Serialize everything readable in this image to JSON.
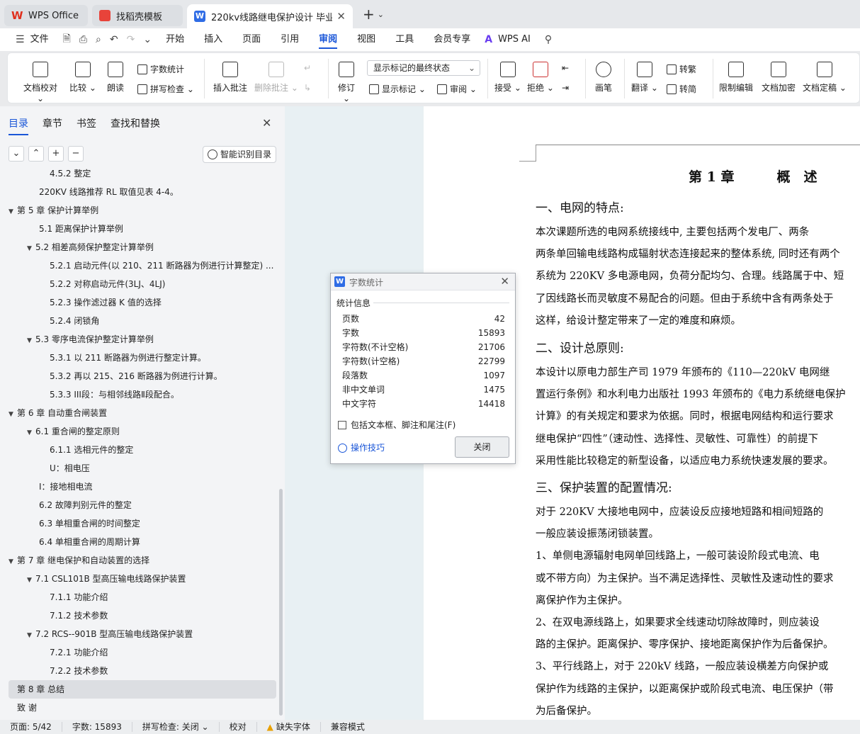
{
  "tabs": {
    "app_label": "WPS Office",
    "template_label": "找稻壳模板",
    "doc_label": "220kv线路继电保护设计  毕业"
  },
  "menu": [
    "文件",
    "开始",
    "插入",
    "页面",
    "引用",
    "审阅",
    "视图",
    "工具",
    "会员专享",
    "WPS AI"
  ],
  "menu_active": "审阅",
  "ribbon": {
    "proofread": "文档校对",
    "compare": "比较",
    "read_aloud": "朗读",
    "word_count": "字数统计",
    "spell_check": "拼写检查",
    "insert_comment": "插入批注",
    "delete_comment": "删除批注",
    "track": "修订",
    "markup_dropdown": "显示标记的最终状态",
    "show_markup": "显示标记",
    "review": "审阅",
    "accept": "接受",
    "reject": "拒绝",
    "pen": "画笔",
    "translate": "翻译",
    "to_trad": "转繁",
    "to_simp": "转简",
    "restrict": "限制编辑",
    "encrypt": "文档加密",
    "finalize": "文档定稿"
  },
  "panel": {
    "tabs": [
      "目录",
      "章节",
      "书签",
      "查找和替换"
    ],
    "smart_toc": "智能识别目录",
    "toc": [
      {
        "text": "4.5.2   整定",
        "level": 3,
        "tri": ""
      },
      {
        "text": "220KV 线路推荐 RL 取值见表 4-4。",
        "level": 2,
        "tri": ""
      },
      {
        "text": "第 5 章   保护计算举例",
        "level": 1,
        "tri": "▼"
      },
      {
        "text": "5.1  距离保护计算举例",
        "level": 2,
        "tri": ""
      },
      {
        "text": "5.2   相差高频保护整定计算举例",
        "level": 2,
        "tri": "▼"
      },
      {
        "text": "5.2.1 启动元件(以 210、211 断路器为例进行计算整定) ...",
        "level": 3,
        "tri": ""
      },
      {
        "text": "5.2.2 对称启动元件(3LJ、4LJ)",
        "level": 3,
        "tri": ""
      },
      {
        "text": "5.2.3 操作滤过器 K 值的选择",
        "level": 3,
        "tri": ""
      },
      {
        "text": "5.2.4    闭锁角",
        "level": 3,
        "tri": ""
      },
      {
        "text": "5.3    零序电流保护整定计算举例",
        "level": 2,
        "tri": "▼"
      },
      {
        "text": "5.3.1    以 211 断路器为例进行整定计算。",
        "level": 3,
        "tri": ""
      },
      {
        "text": "5.3.2    再以 215、216 断路器为例进行计算。",
        "level": 3,
        "tri": ""
      },
      {
        "text": "5.3.3    III段：与相邻线路Ⅱ段配合。",
        "level": 3,
        "tri": ""
      },
      {
        "text": "第 6 章   自动重合闸装置",
        "level": 1,
        "tri": "▼"
      },
      {
        "text": "6.1  重合闸的整定原则",
        "level": 2,
        "tri": "▼"
      },
      {
        "text": "6.1.1 选相元件的整定",
        "level": 3,
        "tri": ""
      },
      {
        "text": "U：相电压",
        "level": 3,
        "tri": ""
      },
      {
        "text": "I：接地相电流",
        "level": 2,
        "tri": ""
      },
      {
        "text": "6.2    故障判别元件的整定",
        "level": 2,
        "tri": ""
      },
      {
        "text": "6.3 单相重合闸的时间整定",
        "level": 2,
        "tri": ""
      },
      {
        "text": "6.4    单相重合闸的周期计算",
        "level": 2,
        "tri": ""
      },
      {
        "text": "第 7 章  继电保护和自动装置的选择",
        "level": 1,
        "tri": "▼"
      },
      {
        "text": "7.1 CSL101B 型高压输电线路保护装置",
        "level": 2,
        "tri": "▼"
      },
      {
        "text": "7.1.1 功能介绍",
        "level": 3,
        "tri": ""
      },
      {
        "text": "7.1.2 技术参数",
        "level": 3,
        "tri": ""
      },
      {
        "text": "7.2    RCS--901B 型高压输电线路保护装置",
        "level": 2,
        "tri": "▼"
      },
      {
        "text": "7.2.1 功能介绍",
        "level": 3,
        "tri": ""
      },
      {
        "text": "7.2.2    技术参数",
        "level": 3,
        "tri": ""
      },
      {
        "text": "第 8 章    总结",
        "level": 1,
        "tri": "",
        "selected": true
      },
      {
        "text": "致        谢",
        "level": 1,
        "tri": ""
      }
    ]
  },
  "doc": {
    "chapter": "第 1 章",
    "chapter_name": "概　述",
    "h1": "一、电网的特点:",
    "p1": [
      "        本次课题所选的电网系统接线中, 主要包括两个发电厂、两条",
      "两条单回输电线路构成辐射状态连接起来的整体系统, 同时还有两个",
      "系统为 220KV 多电源电网，负荷分配均匀、合理。线路属于中、短",
      "了因线路长而灵敏度不易配合的问题。但由于系统中含有两条处于",
      "这样，给设计整定带来了一定的难度和麻烦。"
    ],
    "h2": "二、设计总原则:",
    "p2": [
      "        本设计以原电力部生产司 1979 年颁布的《110—220kV 电网继",
      "置运行条例》和水利电力出版社 1993 年颁布的《电力系统继电保护",
      "计算》的有关规定和要求为依据。同时，根据电网结构和运行要求",
      "继电保护“四性”（速动性、选择性、灵敏性、可靠性）的前提下",
      "采用性能比较稳定的新型设备，以适应电力系统快速发展的要求。"
    ],
    "h3": "三、保护装置的配置情况:",
    "p3": [
      "        对于 220KV 大接地电网中，应装设反应接地短路和相间短路的",
      "一般应装设振荡闭锁装置。",
      "     1、单侧电源辐射电网单回线路上，一般可装设阶段式电流、电",
      "或不带方向）为主保护。当不满足选择性、灵敏性及速动性的要求",
      "离保护作为主保护。",
      "     2、在双电源线路上，如果要求全线速动切除故障时，则应装设",
      "路的主保护。距离保护、零序保护、接地距离保护作为后备保护。",
      "     3、平行线路上，对于 220kV 线路，一般应装设横差方向保护或",
      "保护作为线路的主保护，以距离保护或阶段式电流、电压保护（带",
      "为后备保护。"
    ]
  },
  "dialog": {
    "title": "字数统计",
    "section": "统计信息",
    "rows": [
      {
        "label": "页数",
        "value": "42"
      },
      {
        "label": "字数",
        "value": "15893"
      },
      {
        "label": "字符数(不计空格)",
        "value": "21706"
      },
      {
        "label": "字符数(计空格)",
        "value": "22799"
      },
      {
        "label": "段落数",
        "value": "1097"
      },
      {
        "label": "非中文单词",
        "value": "1475"
      },
      {
        "label": "中文字符",
        "value": "14418"
      }
    ],
    "checkbox_label": "包括文本框、脚注和尾注(F)",
    "tips": "操作技巧",
    "close": "关闭"
  },
  "status": {
    "page": "页面: 5/42",
    "words": "字数: 15893",
    "spell": "拼写检查: 关闭",
    "proof": "校对",
    "missing_font": "缺失字体",
    "compat": "兼容模式"
  }
}
